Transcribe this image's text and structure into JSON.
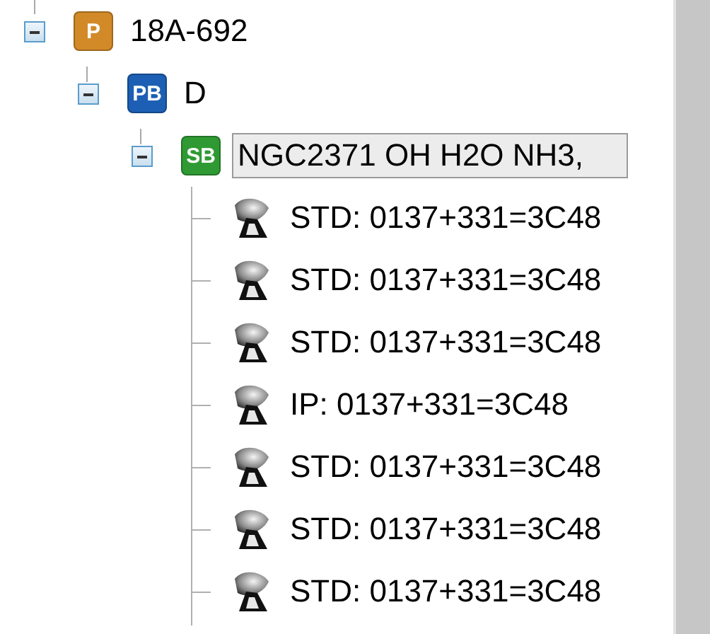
{
  "tree": [
    {
      "kind": "project",
      "badge": "P",
      "label": "18A-692",
      "expanded": true,
      "selected": false,
      "children": [
        {
          "kind": "program_block",
          "badge": "PB",
          "label": "D",
          "expanded": true,
          "selected": false,
          "children": [
            {
              "kind": "scheduling_block",
              "badge": "SB",
              "label": "NGC2371 OH H2O NH3,",
              "expanded": true,
              "selected": true,
              "children": [
                {
                  "kind": "scan",
                  "label": "STD: 0137+331=3C48",
                  "selected": false
                },
                {
                  "kind": "scan",
                  "label": "STD: 0137+331=3C48",
                  "selected": false
                },
                {
                  "kind": "scan",
                  "label": "STD: 0137+331=3C48",
                  "selected": false
                },
                {
                  "kind": "scan",
                  "label": "IP: 0137+331=3C48",
                  "selected": false
                },
                {
                  "kind": "scan",
                  "label": "STD: 0137+331=3C48",
                  "selected": false
                },
                {
                  "kind": "scan",
                  "label": "STD: 0137+331=3C48",
                  "selected": false
                },
                {
                  "kind": "scan",
                  "label": "STD: 0137+331=3C48",
                  "selected": false
                }
              ]
            }
          ]
        }
      ]
    }
  ]
}
